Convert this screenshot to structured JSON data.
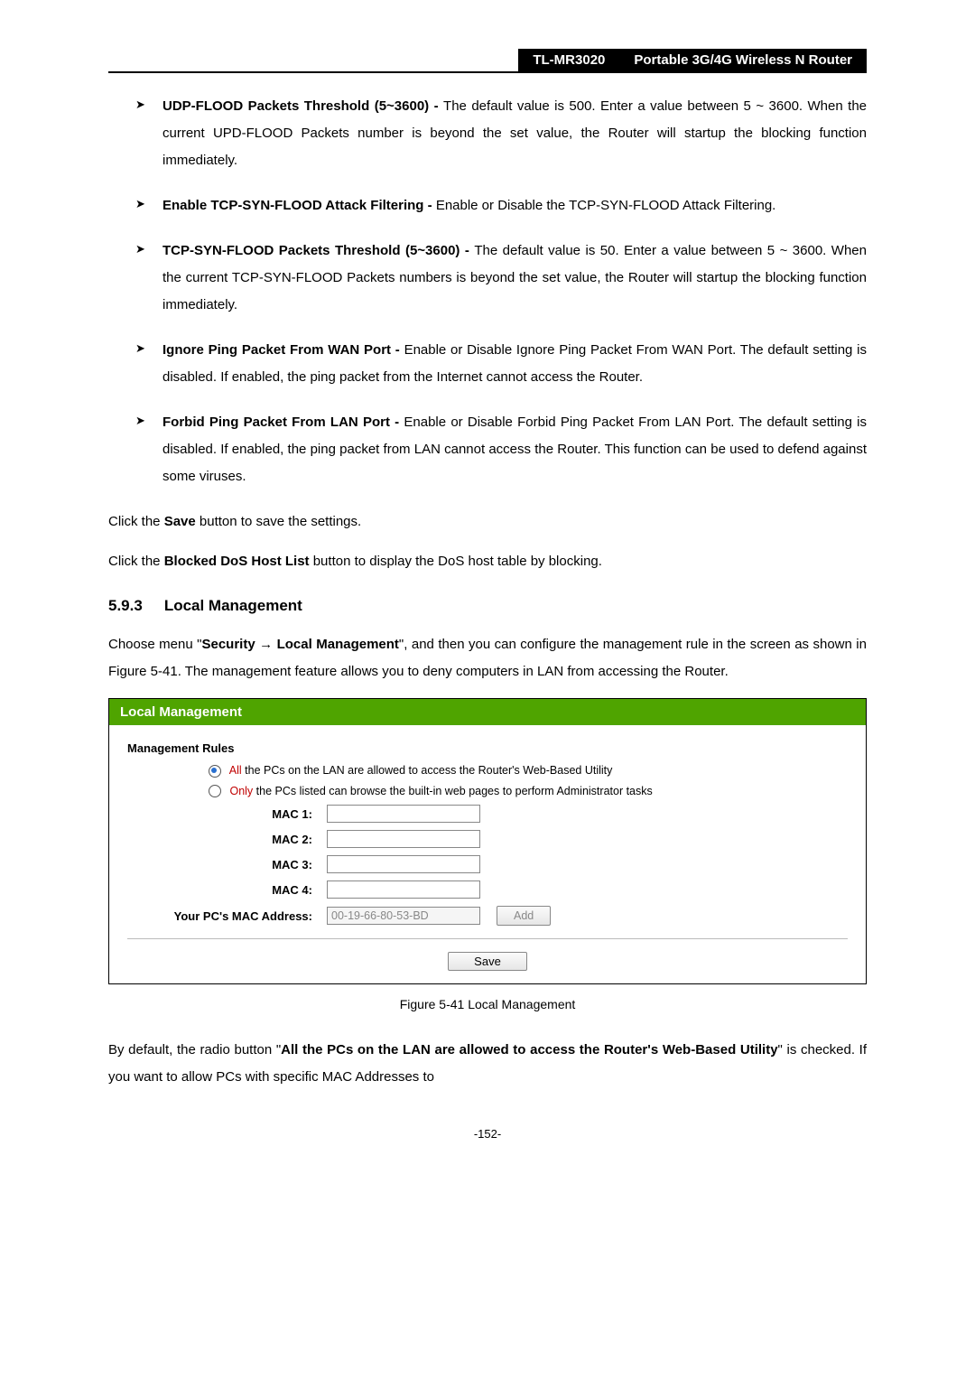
{
  "header": {
    "model": "TL-MR3020",
    "product": "Portable 3G/4G Wireless N Router"
  },
  "bullets": [
    {
      "title": "UDP-FLOOD Packets Threshold (5~3600) - ",
      "body": "The default value is 500. Enter a value between 5 ~ 3600. When the current UPD-FLOOD Packets number is beyond the set value, the Router will startup the blocking function immediately."
    },
    {
      "title": "Enable TCP-SYN-FLOOD Attack Filtering - ",
      "body": "Enable or Disable the TCP-SYN-FLOOD Attack Filtering."
    },
    {
      "title": "TCP-SYN-FLOOD Packets Threshold (5~3600) - ",
      "body": "The default value is 50. Enter a value between 5 ~ 3600. When the current TCP-SYN-FLOOD Packets numbers is beyond the set value, the Router will startup the blocking function immediately."
    },
    {
      "title": "Ignore Ping Packet From WAN Port - ",
      "body": "Enable or Disable Ignore Ping Packet From WAN Port. The default setting is disabled. If enabled, the ping packet from the Internet cannot access the Router."
    },
    {
      "title": "Forbid Ping Packet From LAN Port - ",
      "body": "Enable or Disable Forbid Ping Packet From LAN Port. The default setting is disabled. If enabled, the ping packet from LAN cannot access the Router. This function can be used to defend against some viruses."
    }
  ],
  "save_line": {
    "pre": "Click the ",
    "bold": "Save",
    "post": " button to save the settings."
  },
  "blocked_line": {
    "pre": "Click the ",
    "bold": "Blocked DoS Host List",
    "post": " button to display the DoS host table by blocking."
  },
  "section": {
    "num": "5.9.3",
    "title": "Local Management"
  },
  "intro": {
    "p1_a": "Choose menu \"",
    "p1_b": "Security",
    "p1_arrow": " → ",
    "p1_c": " Local Management",
    "p1_d": "\", and then you can configure the management rule in the screen as shown in Figure 5-41. The management feature allows you to deny computers in LAN from accessing the Router."
  },
  "figure": {
    "title": "Local Management",
    "rules_label": "Management Rules",
    "radio_all": {
      "red": "All",
      "rest": " the PCs on the LAN are allowed to access the Router's Web-Based Utility"
    },
    "radio_only": {
      "red": "Only",
      "rest": " the PCs listed can browse the built-in web pages to perform Administrator tasks"
    },
    "mac_labels": [
      "MAC 1:",
      "MAC 2:",
      "MAC 3:",
      "MAC 4:"
    ],
    "pc_mac_label": "Your PC's MAC Address:",
    "pc_mac_value": "00-19-66-80-53-BD",
    "add_btn": "Add",
    "save_btn": "Save"
  },
  "caption": "Figure 5-41 Local Management",
  "closing": {
    "a": "By default, the radio button \"",
    "b": "All the PCs on the LAN are allowed to access the Router's Web-Based Utility",
    "c": "\" is checked. If you want to allow PCs with specific MAC Addresses to"
  },
  "page_number": "-152-"
}
